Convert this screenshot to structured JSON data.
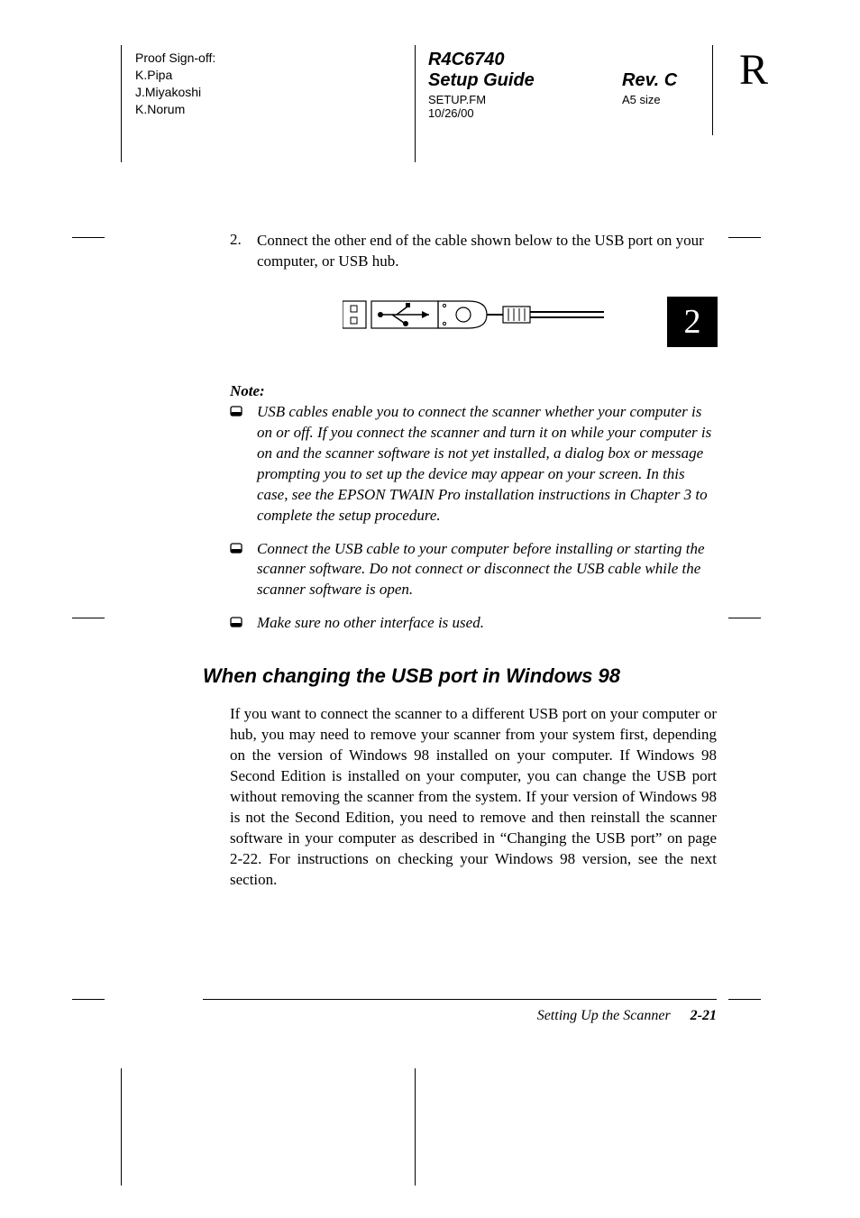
{
  "proof": {
    "heading": "Proof Sign-off:",
    "names": [
      "K.Pipa",
      "J.Miyakoshi",
      "K.Norum"
    ]
  },
  "doc": {
    "code": "R4C6740",
    "title": "Setup Guide",
    "file": "SETUP.FM",
    "date": "10/26/00",
    "rev": "Rev. C",
    "paper": "A5 size",
    "side_mark": "R"
  },
  "chapter_badge": "2",
  "step": {
    "num": "2.",
    "text": "Connect the other end of the cable shown below to the USB port on your computer, or USB hub."
  },
  "note": {
    "heading": "Note:",
    "items": [
      "USB cables enable you to connect the scanner whether your computer is on or off. If you connect the scanner and turn it on while your computer is on and the scanner software is not yet installed, a dialog box or message prompting you to set up the device may appear on your screen. In this case, see the EPSON TWAIN Pro installation instructions in Chapter 3 to complete the setup procedure.",
      "Connect the USB cable to your computer before installing or starting the scanner software. Do not connect or disconnect the USB cable while the scanner software is open.",
      "Make sure no other interface is used."
    ]
  },
  "section": {
    "heading": "When changing the USB port in Windows 98",
    "para": "If you want to connect the scanner to a different USB port on your computer or hub, you may need to remove your scanner from your system first, depending on the version of Windows 98 installed on your computer. If Windows 98 Second Edition is installed on your computer, you can change the USB port without removing the scanner from the system. If your version of Windows 98 is not the Second Edition, you need to remove and then reinstall the scanner software in your computer as described in “Changing the USB port” on page 2-22. For instructions on checking your Windows 98 version, see the next section."
  },
  "footer": {
    "chapter": "Setting Up the Scanner",
    "page": "2-21"
  }
}
